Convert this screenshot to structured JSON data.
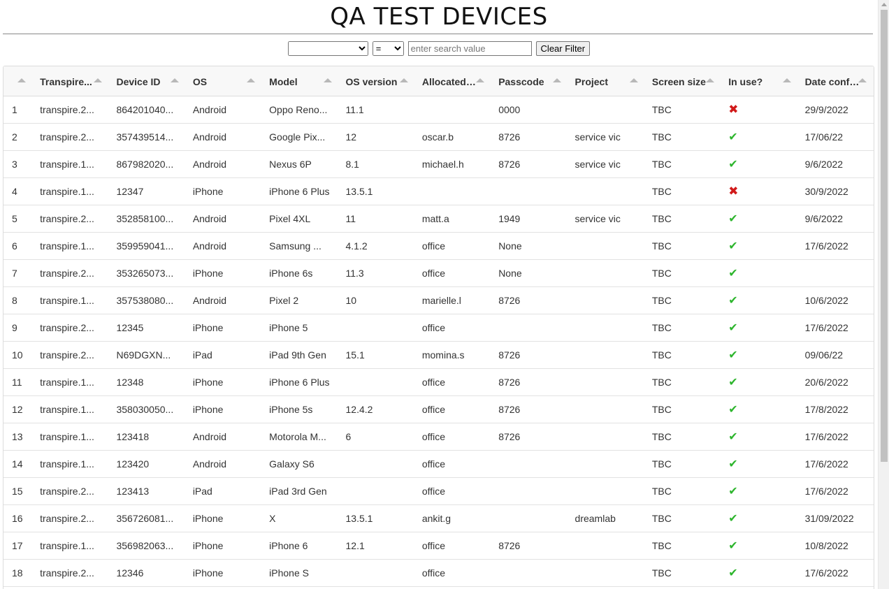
{
  "page": {
    "title": "QA TEST DEVICES"
  },
  "filter": {
    "field_value": "",
    "operator_value": "=",
    "search_placeholder": "enter search value",
    "search_value": "",
    "clear_label": "Clear Filter"
  },
  "table": {
    "columns": [
      "",
      "Transpire...",
      "Device ID",
      "OS",
      "Model",
      "OS version",
      "Allocated to",
      "Passcode",
      "Project",
      "Screen size",
      "In use?",
      "Date confirmed"
    ],
    "rows": [
      {
        "n": "1",
        "t": "transpire.2...",
        "d": "864201040...",
        "os": "Android",
        "model": "Oppo Reno...",
        "ver": "11.1",
        "alloc": "",
        "pass": "0000",
        "proj": "",
        "screen": "TBC",
        "inuse": false,
        "date": "29/9/2022"
      },
      {
        "n": "2",
        "t": "transpire.2...",
        "d": "357439514...",
        "os": "Android",
        "model": "Google Pix...",
        "ver": "12",
        "alloc": "oscar.b",
        "pass": "8726",
        "proj": "service vic",
        "screen": "TBC",
        "inuse": true,
        "date": "17/06/22"
      },
      {
        "n": "3",
        "t": "transpire.1...",
        "d": "867982020...",
        "os": "Android",
        "model": "Nexus 6P",
        "ver": "8.1",
        "alloc": "michael.h",
        "pass": "8726",
        "proj": "service vic",
        "screen": "TBC",
        "inuse": true,
        "date": "9/6/2022"
      },
      {
        "n": "4",
        "t": "transpire.1...",
        "d": "12347",
        "os": "iPhone",
        "model": "iPhone 6 Plus",
        "ver": "13.5.1",
        "alloc": "",
        "pass": "",
        "proj": "",
        "screen": "TBC",
        "inuse": false,
        "date": "30/9/2022"
      },
      {
        "n": "5",
        "t": "transpire.2...",
        "d": "352858100...",
        "os": "Android",
        "model": "Pixel 4XL",
        "ver": "11",
        "alloc": "matt.a",
        "pass": "1949",
        "proj": "service vic",
        "screen": "TBC",
        "inuse": true,
        "date": "9/6/2022"
      },
      {
        "n": "6",
        "t": "transpire.1...",
        "d": "359959041...",
        "os": "Android",
        "model": "Samsung ...",
        "ver": "4.1.2",
        "alloc": "office",
        "pass": "None",
        "proj": "",
        "screen": "TBC",
        "inuse": true,
        "date": "17/6/2022"
      },
      {
        "n": "7",
        "t": "transpire.2...",
        "d": "353265073...",
        "os": "iPhone",
        "model": "iPhone 6s",
        "ver": "11.3",
        "alloc": "office",
        "pass": "None",
        "proj": "",
        "screen": "TBC",
        "inuse": true,
        "date": ""
      },
      {
        "n": "8",
        "t": "transpire.1...",
        "d": "357538080...",
        "os": "Android",
        "model": "Pixel 2",
        "ver": "10",
        "alloc": "marielle.l",
        "pass": "8726",
        "proj": "",
        "screen": "TBC",
        "inuse": true,
        "date": "10/6/2022"
      },
      {
        "n": "9",
        "t": "transpire.2...",
        "d": "12345",
        "os": "iPhone",
        "model": "iPhone 5",
        "ver": "",
        "alloc": "office",
        "pass": "",
        "proj": "",
        "screen": "TBC",
        "inuse": true,
        "date": "17/6/2022"
      },
      {
        "n": "10",
        "t": "transpire.2...",
        "d": "N69DGXN...",
        "os": "iPad",
        "model": "iPad 9th Gen",
        "ver": "15.1",
        "alloc": "momina.s",
        "pass": "8726",
        "proj": "",
        "screen": "TBC",
        "inuse": true,
        "date": "09/06/22"
      },
      {
        "n": "11",
        "t": "transpire.1...",
        "d": "12348",
        "os": "iPhone",
        "model": "iPhone 6 Plus",
        "ver": "",
        "alloc": "office",
        "pass": "8726",
        "proj": "",
        "screen": "TBC",
        "inuse": true,
        "date": "20/6/2022"
      },
      {
        "n": "12",
        "t": "transpire.1...",
        "d": "358030050...",
        "os": "iPhone",
        "model": "iPhone 5s",
        "ver": "12.4.2",
        "alloc": "office",
        "pass": "8726",
        "proj": "",
        "screen": "TBC",
        "inuse": true,
        "date": "17/8/2022"
      },
      {
        "n": "13",
        "t": "transpire.1...",
        "d": "123418",
        "os": "Android",
        "model": "Motorola M...",
        "ver": "6",
        "alloc": "office",
        "pass": "8726",
        "proj": "",
        "screen": "TBC",
        "inuse": true,
        "date": "17/6/2022"
      },
      {
        "n": "14",
        "t": "transpire.1...",
        "d": "123420",
        "os": "Android",
        "model": "Galaxy S6",
        "ver": "",
        "alloc": "office",
        "pass": "",
        "proj": "",
        "screen": "TBC",
        "inuse": true,
        "date": "17/6/2022"
      },
      {
        "n": "15",
        "t": "transpire.2...",
        "d": "123413",
        "os": "iPad",
        "model": "iPad 3rd Gen",
        "ver": "",
        "alloc": "office",
        "pass": "",
        "proj": "",
        "screen": "TBC",
        "inuse": true,
        "date": "17/6/2022"
      },
      {
        "n": "16",
        "t": "transpire.2...",
        "d": "356726081...",
        "os": "iPhone",
        "model": "X",
        "ver": "13.5.1",
        "alloc": "ankit.g",
        "pass": "",
        "proj": "dreamlab",
        "screen": "TBC",
        "inuse": true,
        "date": "31/09/2022"
      },
      {
        "n": "17",
        "t": "transpire.1...",
        "d": "356982063...",
        "os": "iPhone",
        "model": "iPhone 6",
        "ver": "12.1",
        "alloc": "office",
        "pass": "8726",
        "proj": "",
        "screen": "TBC",
        "inuse": true,
        "date": "10/8/2022"
      },
      {
        "n": "18",
        "t": "transpire.2...",
        "d": "12346",
        "os": "iPhone",
        "model": "iPhone S",
        "ver": "",
        "alloc": "office",
        "pass": "",
        "proj": "",
        "screen": "TBC",
        "inuse": true,
        "date": "17/6/2022"
      }
    ]
  },
  "icons": {
    "in_use_true": "✔",
    "in_use_false": "✖",
    "check_color": "#2db52d",
    "cross_color": "#d11a1a"
  }
}
